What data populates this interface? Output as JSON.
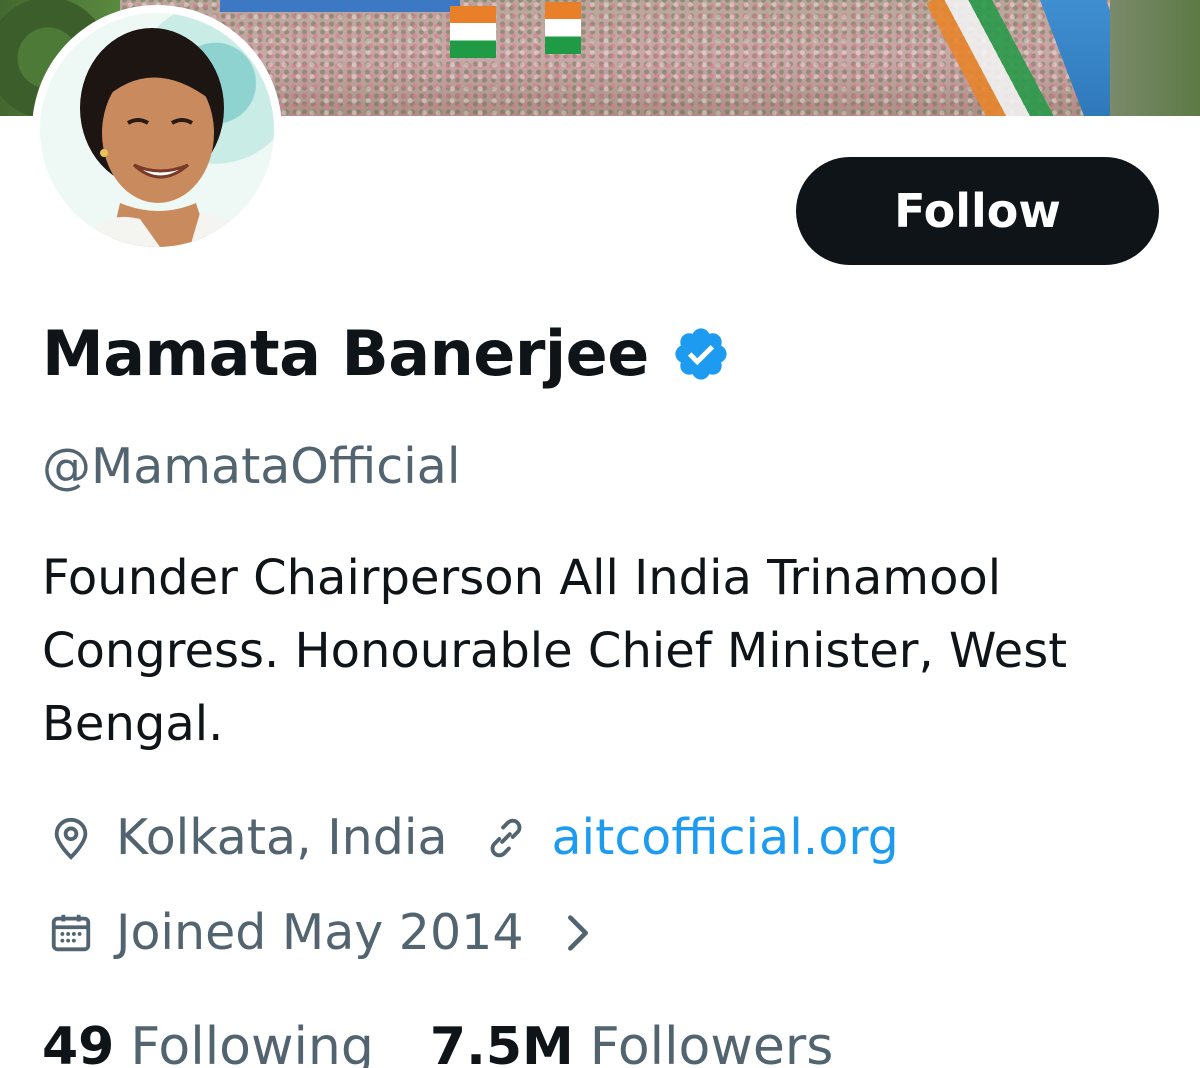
{
  "profile": {
    "display_name": "Mamata Banerjee",
    "handle": "@MamataOfficial",
    "bio": "Founder Chairperson All India Trinamool Congress. Honourable Chief Minister, West Bengal.",
    "location": "Kolkata, India",
    "website": "aitcofficial.org",
    "joined": "Joined May 2014",
    "verified_icon": "verified-badge-icon"
  },
  "actions": {
    "follow_label": "Follow"
  },
  "stats": {
    "following_count": "49",
    "following_label": "Following",
    "followers_count": "7.5M",
    "followers_label": "Followers"
  },
  "colors": {
    "accent": "#1d9bf0",
    "secondary_text": "#536471",
    "primary_text": "#0f1419",
    "button_bg": "#0f1419"
  }
}
